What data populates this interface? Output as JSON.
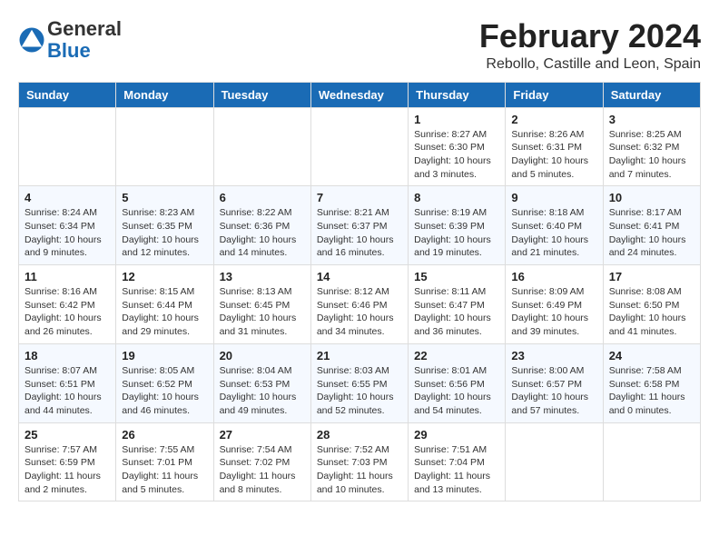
{
  "logo": {
    "general": "General",
    "blue": "Blue"
  },
  "title": "February 2024",
  "location": "Rebollo, Castille and Leon, Spain",
  "days_of_week": [
    "Sunday",
    "Monday",
    "Tuesday",
    "Wednesday",
    "Thursday",
    "Friday",
    "Saturday"
  ],
  "weeks": [
    [
      {
        "day": "",
        "info": ""
      },
      {
        "day": "",
        "info": ""
      },
      {
        "day": "",
        "info": ""
      },
      {
        "day": "",
        "info": ""
      },
      {
        "day": "1",
        "info": "Sunrise: 8:27 AM\nSunset: 6:30 PM\nDaylight: 10 hours and 3 minutes."
      },
      {
        "day": "2",
        "info": "Sunrise: 8:26 AM\nSunset: 6:31 PM\nDaylight: 10 hours and 5 minutes."
      },
      {
        "day": "3",
        "info": "Sunrise: 8:25 AM\nSunset: 6:32 PM\nDaylight: 10 hours and 7 minutes."
      }
    ],
    [
      {
        "day": "4",
        "info": "Sunrise: 8:24 AM\nSunset: 6:34 PM\nDaylight: 10 hours and 9 minutes."
      },
      {
        "day": "5",
        "info": "Sunrise: 8:23 AM\nSunset: 6:35 PM\nDaylight: 10 hours and 12 minutes."
      },
      {
        "day": "6",
        "info": "Sunrise: 8:22 AM\nSunset: 6:36 PM\nDaylight: 10 hours and 14 minutes."
      },
      {
        "day": "7",
        "info": "Sunrise: 8:21 AM\nSunset: 6:37 PM\nDaylight: 10 hours and 16 minutes."
      },
      {
        "day": "8",
        "info": "Sunrise: 8:19 AM\nSunset: 6:39 PM\nDaylight: 10 hours and 19 minutes."
      },
      {
        "day": "9",
        "info": "Sunrise: 8:18 AM\nSunset: 6:40 PM\nDaylight: 10 hours and 21 minutes."
      },
      {
        "day": "10",
        "info": "Sunrise: 8:17 AM\nSunset: 6:41 PM\nDaylight: 10 hours and 24 minutes."
      }
    ],
    [
      {
        "day": "11",
        "info": "Sunrise: 8:16 AM\nSunset: 6:42 PM\nDaylight: 10 hours and 26 minutes."
      },
      {
        "day": "12",
        "info": "Sunrise: 8:15 AM\nSunset: 6:44 PM\nDaylight: 10 hours and 29 minutes."
      },
      {
        "day": "13",
        "info": "Sunrise: 8:13 AM\nSunset: 6:45 PM\nDaylight: 10 hours and 31 minutes."
      },
      {
        "day": "14",
        "info": "Sunrise: 8:12 AM\nSunset: 6:46 PM\nDaylight: 10 hours and 34 minutes."
      },
      {
        "day": "15",
        "info": "Sunrise: 8:11 AM\nSunset: 6:47 PM\nDaylight: 10 hours and 36 minutes."
      },
      {
        "day": "16",
        "info": "Sunrise: 8:09 AM\nSunset: 6:49 PM\nDaylight: 10 hours and 39 minutes."
      },
      {
        "day": "17",
        "info": "Sunrise: 8:08 AM\nSunset: 6:50 PM\nDaylight: 10 hours and 41 minutes."
      }
    ],
    [
      {
        "day": "18",
        "info": "Sunrise: 8:07 AM\nSunset: 6:51 PM\nDaylight: 10 hours and 44 minutes."
      },
      {
        "day": "19",
        "info": "Sunrise: 8:05 AM\nSunset: 6:52 PM\nDaylight: 10 hours and 46 minutes."
      },
      {
        "day": "20",
        "info": "Sunrise: 8:04 AM\nSunset: 6:53 PM\nDaylight: 10 hours and 49 minutes."
      },
      {
        "day": "21",
        "info": "Sunrise: 8:03 AM\nSunset: 6:55 PM\nDaylight: 10 hours and 52 minutes."
      },
      {
        "day": "22",
        "info": "Sunrise: 8:01 AM\nSunset: 6:56 PM\nDaylight: 10 hours and 54 minutes."
      },
      {
        "day": "23",
        "info": "Sunrise: 8:00 AM\nSunset: 6:57 PM\nDaylight: 10 hours and 57 minutes."
      },
      {
        "day": "24",
        "info": "Sunrise: 7:58 AM\nSunset: 6:58 PM\nDaylight: 11 hours and 0 minutes."
      }
    ],
    [
      {
        "day": "25",
        "info": "Sunrise: 7:57 AM\nSunset: 6:59 PM\nDaylight: 11 hours and 2 minutes."
      },
      {
        "day": "26",
        "info": "Sunrise: 7:55 AM\nSunset: 7:01 PM\nDaylight: 11 hours and 5 minutes."
      },
      {
        "day": "27",
        "info": "Sunrise: 7:54 AM\nSunset: 7:02 PM\nDaylight: 11 hours and 8 minutes."
      },
      {
        "day": "28",
        "info": "Sunrise: 7:52 AM\nSunset: 7:03 PM\nDaylight: 11 hours and 10 minutes."
      },
      {
        "day": "29",
        "info": "Sunrise: 7:51 AM\nSunset: 7:04 PM\nDaylight: 11 hours and 13 minutes."
      },
      {
        "day": "",
        "info": ""
      },
      {
        "day": "",
        "info": ""
      }
    ]
  ]
}
